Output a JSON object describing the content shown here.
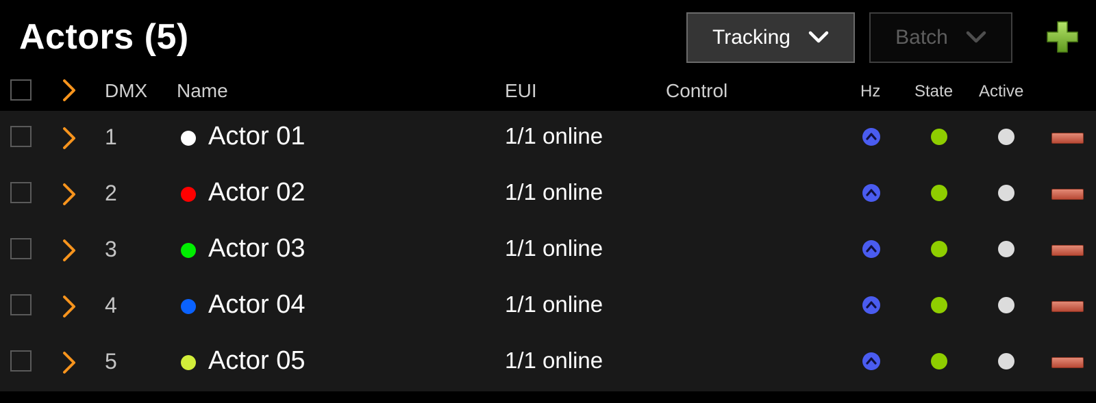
{
  "header": {
    "title": "Actors (5)",
    "tracking_label": "Tracking",
    "batch_label": "Batch"
  },
  "columns": {
    "dmx": "DMX",
    "name": "Name",
    "eui": "EUI",
    "control": "Control",
    "hz": "Hz",
    "state": "State",
    "active": "Active"
  },
  "colors": {
    "accent_orange": "#f7941d",
    "add_green": "#8cc63f",
    "hz_blue": "#4a5cf0",
    "state_green": "#8fce00",
    "active_gray": "#dcdcdc",
    "remove_red": "#c9624c"
  },
  "icons": {
    "expander": "chevron-right-icon",
    "hz": "chevron-up-circle-icon",
    "add": "plus-icon",
    "remove": "minus-icon"
  },
  "rows": [
    {
      "dmx": "1",
      "name": "Actor 01",
      "color": "#ffffff",
      "eui": "1/1 online",
      "control": ""
    },
    {
      "dmx": "2",
      "name": "Actor 02",
      "color": "#ff0000",
      "eui": "1/1 online",
      "control": ""
    },
    {
      "dmx": "3",
      "name": "Actor 03",
      "color": "#00ee00",
      "eui": "1/1 online",
      "control": ""
    },
    {
      "dmx": "4",
      "name": "Actor 04",
      "color": "#0a62ff",
      "eui": "1/1 online",
      "control": ""
    },
    {
      "dmx": "5",
      "name": "Actor 05",
      "color": "#d2ee3a",
      "eui": "1/1 online",
      "control": ""
    }
  ]
}
